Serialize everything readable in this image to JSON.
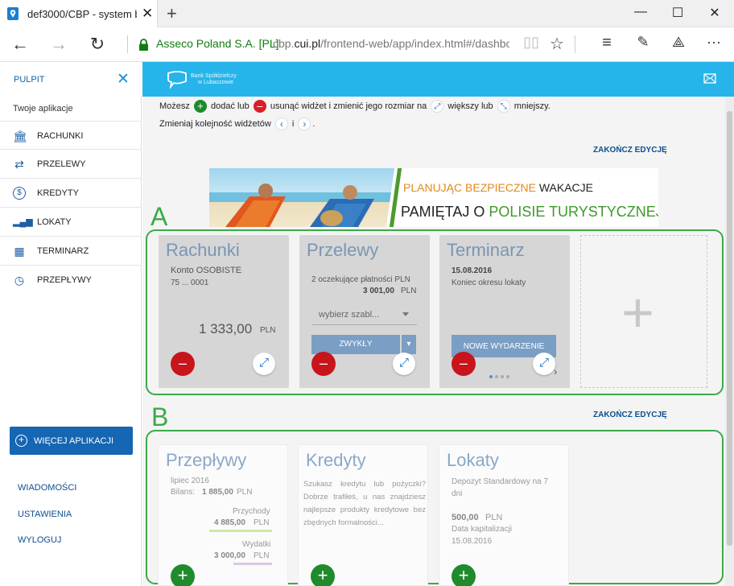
{
  "browser": {
    "tab_title": "def3000/CBP - system b",
    "new_tab": "+",
    "site_identity": "Asseco Poland S.A. [PL]",
    "url_prefix": "cbp.",
    "url_domain": "cui.pl",
    "url_rest": "/frontend-web/app/index.html#/dashboa"
  },
  "sidebar": {
    "title": "PULPIT",
    "subtitle": "Twoje aplikacje",
    "items": [
      {
        "label": "RACHUNKI",
        "icon": "bank-icon"
      },
      {
        "label": "PRZELEWY",
        "icon": "transfer-arrows-icon"
      },
      {
        "label": "KREDYTY",
        "icon": "dollar-coin-icon"
      },
      {
        "label": "LOKATY",
        "icon": "coins-chart-icon"
      },
      {
        "label": "TERMINARZ",
        "icon": "calendar-icon"
      },
      {
        "label": "PRZEPŁYWY",
        "icon": "clock-flow-icon"
      }
    ],
    "more_apps": "WIĘCEJ APLIKACJI",
    "links": [
      "WIADOMOŚCI",
      "USTAWIENIA",
      "WYLOGUJ"
    ]
  },
  "header": {
    "bank_line1": "Bank Spółdzielczy",
    "bank_line2": "w Lubaczowie"
  },
  "hints": {
    "line1_a": "Możesz",
    "line1_b": "dodać lub",
    "line1_c": "usunąć widżet i zmienić jego rozmiar na",
    "line1_d": "większy lub",
    "line1_e": "mniejszy.",
    "line2_a": "Zmieniaj kolejność widżetów",
    "line2_b": "i",
    "line2_c": "."
  },
  "end_edit": "ZAKOŃCZ EDYCJĘ",
  "banner": {
    "w1": "PLANUJĄC BEZPIECZNE",
    "w2": "WAKACJE",
    "w3": "PAMIĘTAJ O",
    "w4": "POLISIE TURYSTYCZNEJ"
  },
  "zones": {
    "a": "A",
    "b": "B"
  },
  "active_widgets": {
    "rachunki": {
      "title": "Rachunki",
      "account": "Konto OSOBISTE",
      "number": "75 ... 0001",
      "balance": "1 333,00",
      "currency": "PLN"
    },
    "przelewy": {
      "title": "Przelewy",
      "pending": "2 oczekujące płatności PLN",
      "amount": "3 001,00",
      "currency": "PLN",
      "template_select": "wybierz szabl...",
      "button": "ZWYKŁY"
    },
    "terminarz": {
      "title": "Terminarz",
      "date": "15.08.2016",
      "event": "Koniec okresu lokaty",
      "button": "NOWE WYDARZENIE"
    }
  },
  "available_widgets": {
    "przeplywy": {
      "title": "Przepływy",
      "period": "lipiec 2016",
      "balance_label": "Bilans:",
      "balance": "1 885,00",
      "currency": "PLN",
      "income_label": "Przychody",
      "income": "4 885,00",
      "expense_label": "Wydatki",
      "expense": "3 000,00"
    },
    "kredyty": {
      "title": "Kredyty",
      "text": "Szukasz kredytu lub pożyczki? Dobrze trafiłeś, u nas znajdziesz najlepsze produkty kredytowe bez zbędnych formalności..."
    },
    "lokaty": {
      "title": "Lokaty",
      "name": "Depozyt Standardowy na 7 dni",
      "amount": "500,00",
      "currency": "PLN",
      "cap_label": "Data kapitalizacji",
      "cap_date": "15.08.2016"
    }
  },
  "colors": {
    "brand": "#26b4ea",
    "primary": "#1566b3",
    "zone_border": "#3aaa4a",
    "remove": "#c8141b",
    "add": "#1f8b2c"
  }
}
